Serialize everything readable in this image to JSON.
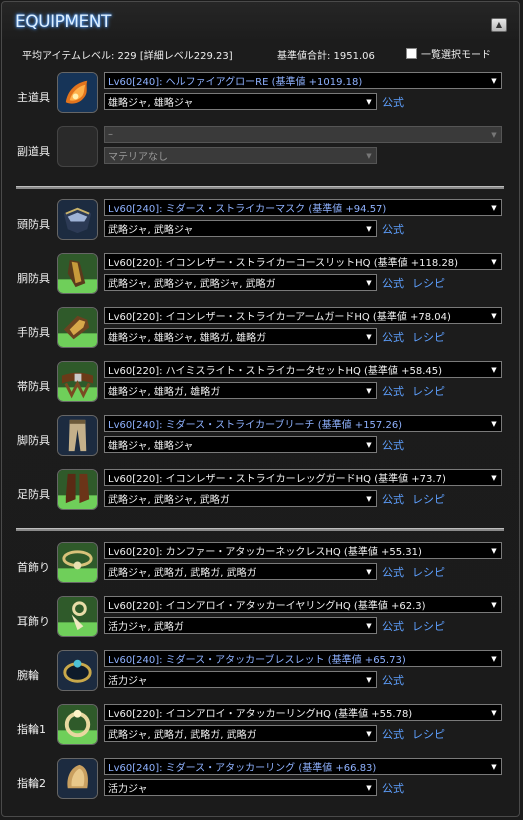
{
  "window": {
    "title": "EQUIPMENT"
  },
  "header": {
    "avg_item_level": "平均アイテムレベル: 229 [詳細レベル229.23]",
    "total_base": "基準値合計: 1951.06",
    "select_mode_label": "一覧選択モード"
  },
  "links": {
    "official": "公式",
    "recipe": "レシピ"
  },
  "slots": {
    "main": {
      "label": "主道具",
      "item": "Lv60[240]: ヘルファイアグローRE (基準値 +1019.18)",
      "materia": "雄略ジャ, 雄略ジャ"
    },
    "off": {
      "label": "副道具",
      "item": "–",
      "materia": "マテリアなし"
    },
    "head": {
      "label": "頭防具",
      "item": "Lv60[240]: ミダース・ストライカーマスク (基準値 +94.57)",
      "materia": "武略ジャ, 武略ジャ"
    },
    "body": {
      "label": "胴防具",
      "item": "Lv60[220]: イコンレザー・ストライカーコースリットHQ (基準値 +118.28)",
      "materia": "武略ジャ, 武略ジャ, 武略ジャ, 武略ガ"
    },
    "hands": {
      "label": "手防具",
      "item": "Lv60[220]: イコンレザー・ストライカーアームガードHQ (基準値 +78.04)",
      "materia": "雄略ジャ, 雄略ジャ, 雄略ガ, 雄略ガ"
    },
    "waist": {
      "label": "帯防具",
      "item": "Lv60[220]: ハイミスライト・ストライカータセットHQ (基準値 +58.45)",
      "materia": "雄略ジャ, 雄略ガ, 雄略ガ"
    },
    "legs": {
      "label": "脚防具",
      "item": "Lv60[240]: ミダース・ストライカーブリーチ (基準値 +157.26)",
      "materia": "雄略ジャ, 雄略ジャ"
    },
    "feet": {
      "label": "足防具",
      "item": "Lv60[220]: イコンレザー・ストライカーレッグガードHQ (基準値 +73.7)",
      "materia": "武略ジャ, 武略ジャ, 武略ガ"
    },
    "neck": {
      "label": "首飾り",
      "item": "Lv60[220]: カンファー・アタッカーネックレスHQ (基準値 +55.31)",
      "materia": "武略ジャ, 武略ガ, 武略ガ, 武略ガ"
    },
    "ears": {
      "label": "耳飾り",
      "item": "Lv60[220]: イコンアロイ・アタッカーイヤリングHQ (基準値 +62.3)",
      "materia": "活力ジャ, 武略ガ"
    },
    "wrist": {
      "label": "腕輪",
      "item": "Lv60[240]: ミダース・アタッカーブレスレット (基準値 +65.73)",
      "materia": "活力ジャ"
    },
    "ring1": {
      "label": "指輪1",
      "item": "Lv60[220]: イコンアロイ・アタッカーリングHQ (基準値 +55.78)",
      "materia": "武略ジャ, 武略ガ, 武略ガ, 武略ガ"
    },
    "ring2": {
      "label": "指輪2",
      "item": "Lv60[240]: ミダース・アタッカーリング (基準値 +66.83)",
      "materia": "活力ジャ"
    }
  },
  "icons": {
    "main": "flame-gloves-icon",
    "off": "empty-slot-icon",
    "head": "mask-icon",
    "body": "coat-icon",
    "hands": "gauntlet-icon",
    "waist": "belt-icon",
    "legs": "breeches-icon",
    "feet": "boots-icon",
    "neck": "necklace-icon",
    "ears": "earring-icon",
    "wrist": "bracelet-icon",
    "ring1": "ring-icon",
    "ring2": "ring-icon"
  },
  "colors": {
    "item_240": "#8fb2ff",
    "item_hq": "#f2f2f2",
    "link": "#5ea0ff",
    "title_glow": "#59a6ff"
  }
}
